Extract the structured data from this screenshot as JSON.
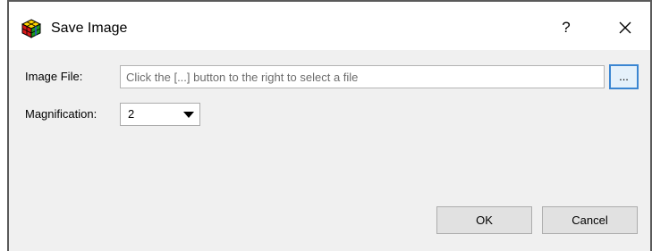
{
  "window": {
    "title": "Save Image",
    "help_glyph": "?",
    "app_icon": "colored-cube-icon",
    "close_icon": "close-icon"
  },
  "form": {
    "image_file_label": "Image File:",
    "image_file_value": "",
    "image_file_placeholder": "Click the [...] button to the right to select a file",
    "browse_label": "...",
    "magnification_label": "Magnification:",
    "magnification_value": "2",
    "magnification_icon": "chevron-down-icon"
  },
  "buttons": {
    "ok_label": "OK",
    "cancel_label": "Cancel"
  },
  "colors": {
    "focus_border": "#3b86d2",
    "client_background": "#f0f0f0"
  }
}
